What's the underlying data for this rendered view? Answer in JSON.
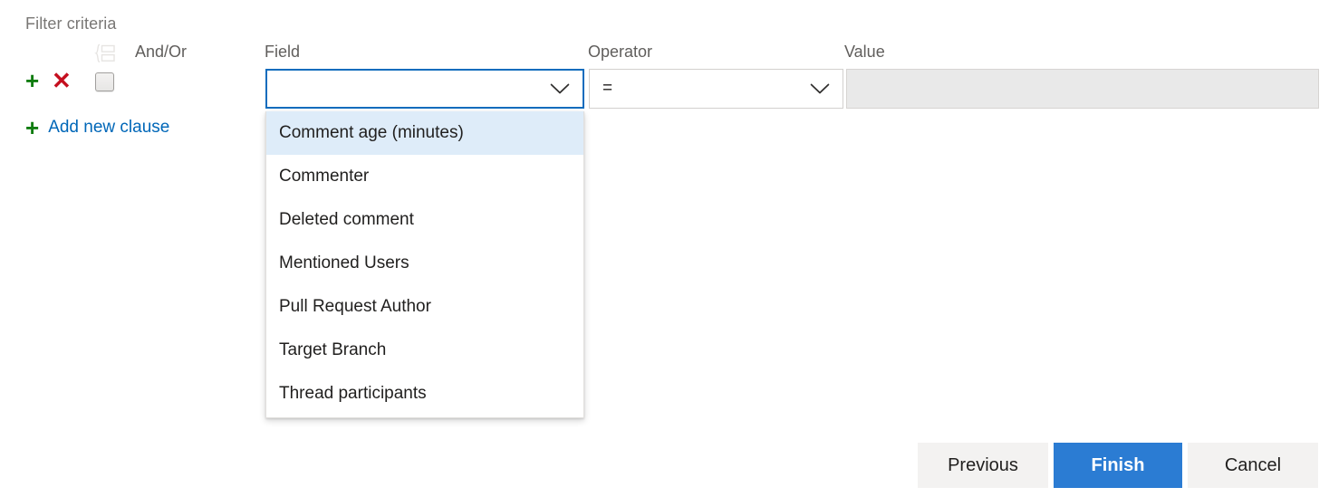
{
  "section": {
    "caption": "Filter criteria"
  },
  "columns": {
    "grouping_icon": "grouping-icon",
    "and_or": "And/Or",
    "field": "Field",
    "operator": "Operator",
    "value": "Value"
  },
  "clause_row": {
    "add_icon": "plus-icon",
    "add_symbol": "+",
    "remove_icon": "close-icon",
    "remove_symbol": "✕",
    "group_toggle": "group-checkbox",
    "and_or_value": "",
    "field_value": "",
    "operator_value": "=",
    "value_value": "",
    "value_disabled": true
  },
  "add_clause": {
    "symbol": "+",
    "label": "Add new clause"
  },
  "field_dropdown": {
    "open": true,
    "selected_index": 0,
    "options": [
      "Comment age (minutes)",
      "Commenter",
      "Deleted comment",
      "Mentioned Users",
      "Pull Request Author",
      "Target Branch",
      "Thread participants"
    ]
  },
  "footer": {
    "previous_label": "Previous",
    "finish_label": "Finish",
    "cancel_label": "Cancel"
  },
  "colors": {
    "accent": "#2b7cd3",
    "focus_border": "#0f6cbd",
    "link": "#0067b8",
    "add_green": "#107c10",
    "remove_red": "#c50f1f",
    "highlight": "#deecf9",
    "disabled_fill": "#e9e9e9",
    "caption_gray": "#797775"
  }
}
